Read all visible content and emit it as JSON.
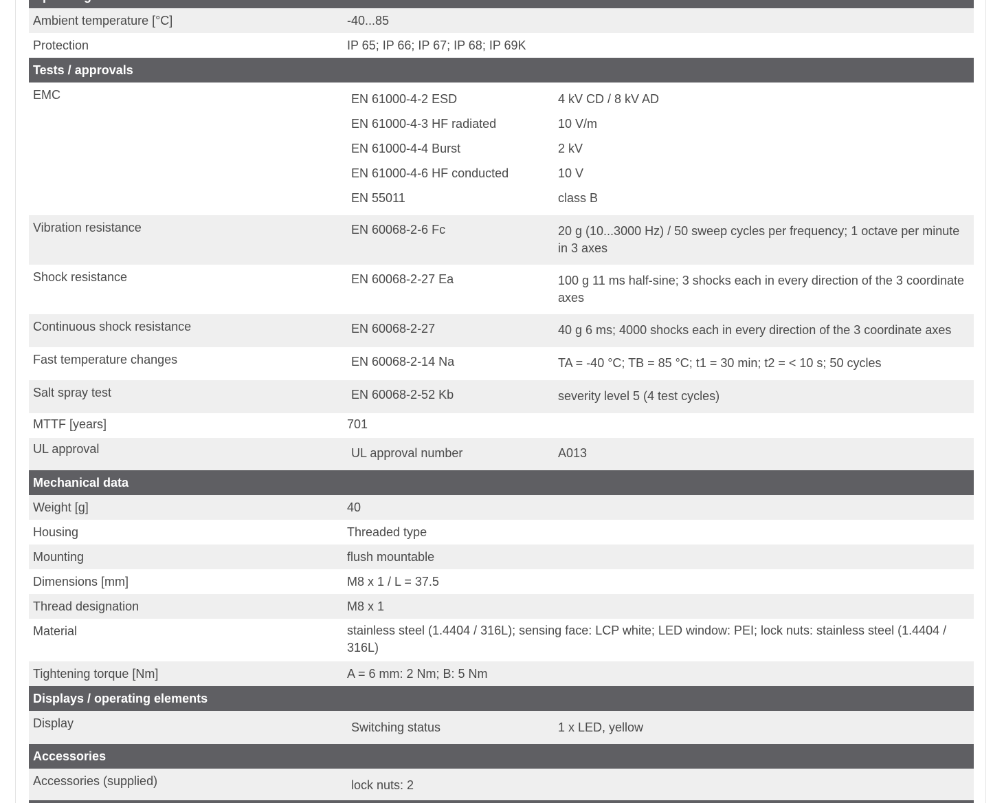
{
  "sections": {
    "operating": {
      "title": "Operating conditions",
      "rows": [
        {
          "label": "Ambient temperature [°C]",
          "value": "-40...85"
        },
        {
          "label": "Protection",
          "value": "IP 65; IP 66; IP 67; IP 68; IP 69K"
        }
      ]
    },
    "tests": {
      "title": "Tests / approvals",
      "emc": {
        "label": "EMC",
        "items": [
          {
            "name": "EN 61000-4-2 ESD",
            "value": "4 kV CD / 8 kV AD"
          },
          {
            "name": "EN 61000-4-3 HF radiated",
            "value": "10 V/m"
          },
          {
            "name": "EN 61000-4-4 Burst",
            "value": "2 kV"
          },
          {
            "name": "EN 61000-4-6 HF conducted",
            "value": "10 V"
          },
          {
            "name": "EN 55011",
            "value": "class B"
          }
        ]
      },
      "vibration": {
        "label": "Vibration resistance",
        "name": "EN 60068-2-6 Fc",
        "value": "20 g (10...3000 Hz) / 50 sweep cycles per frequency; 1 octave per minute in 3 axes"
      },
      "shock": {
        "label": "Shock resistance",
        "name": "EN 60068-2-27 Ea",
        "value": "100 g 11 ms half-sine; 3 shocks each in every direction of the 3 coordinate axes"
      },
      "continuous_shock": {
        "label": "Continuous shock resistance",
        "name": "EN 60068-2-27",
        "value": "40 g 6 ms; 4000 shocks each in every direction of the 3 coordinate axes"
      },
      "fast_temp": {
        "label": "Fast temperature changes",
        "name": "EN 60068-2-14 Na",
        "value": "TA = -40 °C; TB = 85 °C; t1 = 30 min; t2 = < 10 s; 50 cycles"
      },
      "salt_spray": {
        "label": "Salt spray test",
        "name": "EN 60068-2-52 Kb",
        "value": "severity level 5 (4 test cycles)"
      },
      "mttf": {
        "label": "MTTF [years]",
        "value": "701"
      },
      "ul": {
        "label": "UL approval",
        "name": "UL approval number",
        "value": "A013"
      }
    },
    "mechanical": {
      "title": "Mechanical data",
      "weight": {
        "label": "Weight [g]",
        "value": "40"
      },
      "housing": {
        "label": "Housing",
        "value": "Threaded type"
      },
      "mounting": {
        "label": "Mounting",
        "value": "flush mountable"
      },
      "dimensions": {
        "label": "Dimensions [mm]",
        "value": "M8 x 1 / L = 37.5"
      },
      "thread": {
        "label": "Thread designation",
        "value": "M8 x 1"
      },
      "material": {
        "label": "Material",
        "value": "stainless steel (1.4404 / 316L); sensing face: LCP white; LED window: PEI; lock nuts: stainless steel (1.4404 / 316L)"
      },
      "torque": {
        "label": "Tightening torque [Nm]",
        "value": "A = 6 mm: 2 Nm; B: 5 Nm"
      }
    },
    "displays": {
      "title": "Displays / operating elements",
      "display": {
        "label": "Display",
        "name": "Switching status",
        "value": "1 x LED, yellow"
      }
    },
    "accessories": {
      "title": "Accessories",
      "supplied": {
        "label": "Accessories (supplied)",
        "name": "lock nuts: 2"
      }
    }
  },
  "colors": {
    "header_bg": "#5f5f63",
    "row_shade": "#efefef",
    "text": "#4a4a4a"
  }
}
